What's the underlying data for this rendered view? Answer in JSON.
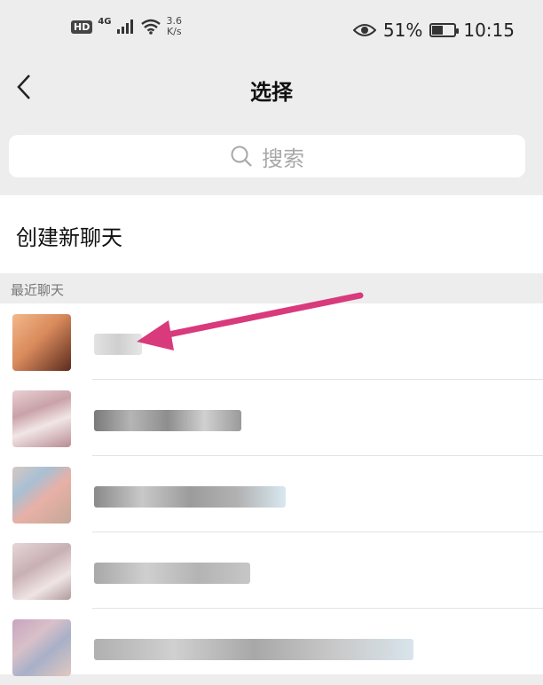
{
  "status_bar": {
    "hd": "HD",
    "network": "4G",
    "speed_value": "3.6",
    "speed_unit": "K/s",
    "battery_percent": "51%",
    "battery_level": 0.51,
    "time": "10:15"
  },
  "nav": {
    "title": "选择"
  },
  "search": {
    "placeholder": "搜索"
  },
  "create_chat": {
    "label": "创建新聊天"
  },
  "recent_section": {
    "label": "最近聊天"
  },
  "colors": {
    "background": "#ededed",
    "arrow": "#d83a7c"
  }
}
